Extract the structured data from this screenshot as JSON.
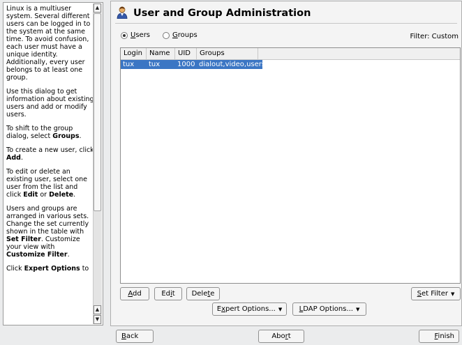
{
  "help": {
    "paragraphs": [
      [
        {
          "t": "Linux is a multiuser system. Several different users can be logged in to the system at the same time. To avoid confusion, each user must have a unique identity. Additionally, every user belongs to at least one group."
        }
      ],
      [
        {
          "t": "Use this dialog to get information about existing users and add or modify users."
        }
      ],
      [
        {
          "t": "To shift to the group dialog, select "
        },
        {
          "t": "Groups",
          "b": true
        },
        {
          "t": "."
        }
      ],
      [
        {
          "t": "To create a new user, click "
        },
        {
          "t": "Add",
          "b": true
        },
        {
          "t": "."
        }
      ],
      [
        {
          "t": "To edit or delete an existing user, select one user from the list and click "
        },
        {
          "t": "Edit",
          "b": true
        },
        {
          "t": " or "
        },
        {
          "t": "Delete",
          "b": true
        },
        {
          "t": "."
        }
      ],
      [
        {
          "t": "Users and groups are arranged in various sets. Change the set currently shown in the table with "
        },
        {
          "t": "Set Filter",
          "b": true
        },
        {
          "t": ". Customize your view with "
        },
        {
          "t": "Customize Filter",
          "b": true
        },
        {
          "t": "."
        }
      ],
      [
        {
          "t": "Click "
        },
        {
          "t": "Expert Options",
          "b": true
        },
        {
          "t": " to"
        }
      ]
    ]
  },
  "dialog": {
    "title": "User and Group Administration",
    "view_users": "Users",
    "view_groups": "Groups",
    "selected_view": "Users",
    "filter_label": "Filter: Custom"
  },
  "table": {
    "columns": [
      "Login",
      "Name",
      "UID",
      "Groups"
    ],
    "rows": [
      {
        "login": "tux",
        "name": "tux",
        "uid": "1000",
        "groups": "dialout,video,users"
      }
    ]
  },
  "buttons": {
    "add": "Add",
    "edit": "Edit",
    "delete": "Delete",
    "set_filter": "Set Filter",
    "expert_options": "Expert Options...",
    "ldap_options": "LDAP Options...",
    "back": "Back",
    "abort": "Abort",
    "finish": "Finish"
  },
  "icons": {
    "title": "user-admin-icon",
    "scroll_up": "arrow-up-icon",
    "scroll_down": "arrow-down-icon",
    "dropdown": "triangle-down-icon"
  },
  "colors": {
    "selection": "#3b76c4",
    "background": "#ebeced"
  }
}
